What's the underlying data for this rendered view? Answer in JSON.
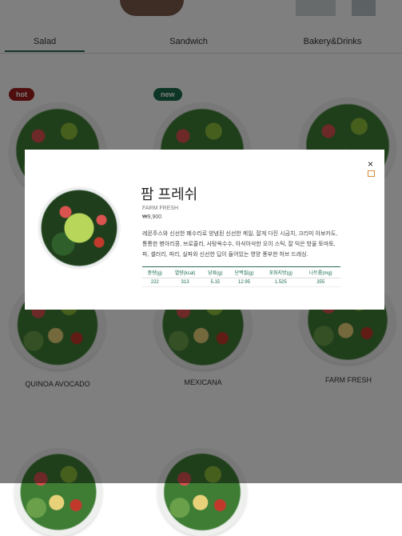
{
  "tabs": [
    "Salad",
    "Sandwich",
    "Bakery&Drinks"
  ],
  "badges": {
    "hot": "hot",
    "new": "new"
  },
  "items": {
    "quinoa_avocado": "QUINOA AVOCADO",
    "mexicana": "MEXICANA",
    "farm_fresh": "FARM FRESH"
  },
  "modal": {
    "close_label": "×",
    "title": "팜 프레쉬",
    "subtitle": "FARM FRESH",
    "price": "₩9,900",
    "description": "레몬주스와 신선한 폐수리로 양념된 신선한 케일, 잘게 다진 시금치, 크리미 아보카도, 통통한 병아리콩, 브로콜리, 사탕옥수수, 아삭아삭한 오이 스틱, 잘 익은 방울 토마토, 파, 셀러리, 파리, 실파와 신선한 딥이 들어있는 영양 풍부한 허브 드레싱.",
    "nutrition": {
      "headers": [
        "중량(g)",
        "열량(kcal)",
        "당류(g)",
        "단백질(g)",
        "포화지방(g)",
        "나트륨(mg)"
      ],
      "values": [
        "222",
        "313",
        "5.15",
        "12.95",
        "1.525",
        "355"
      ]
    }
  }
}
